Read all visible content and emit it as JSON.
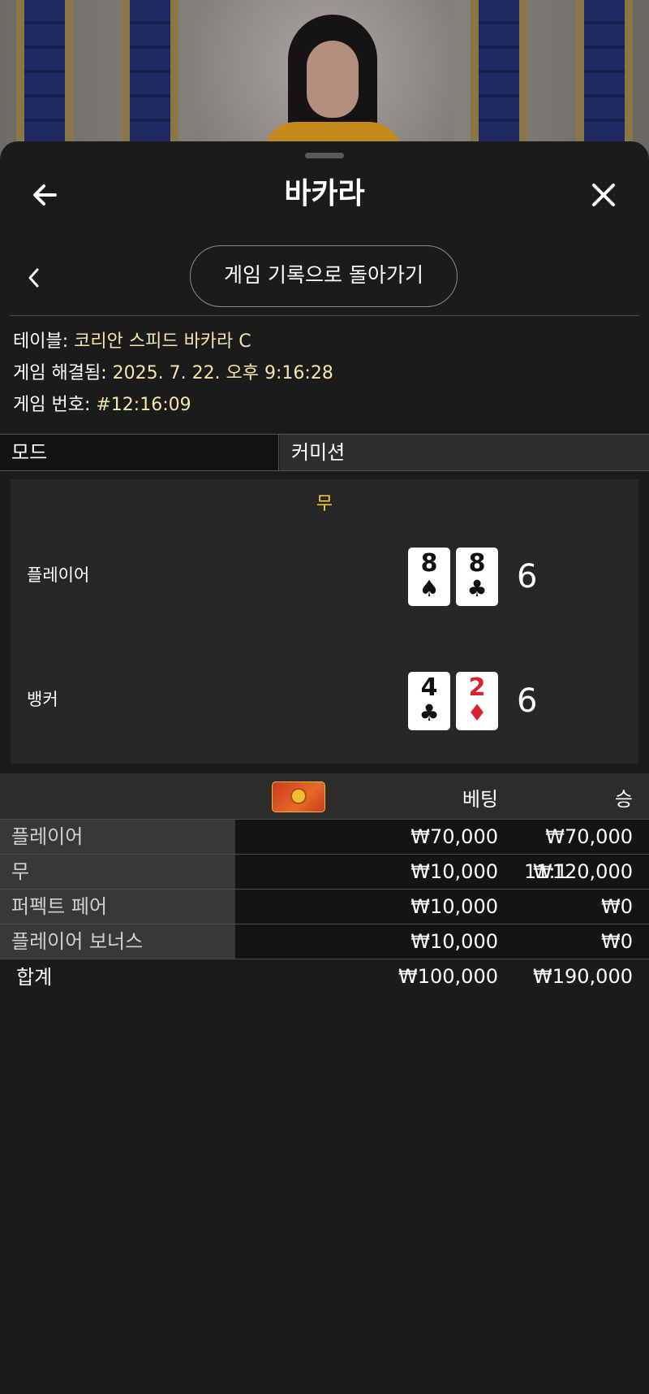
{
  "header": {
    "title": "바카라"
  },
  "history_button": {
    "label": "게임 기록으로 돌아가기"
  },
  "info": {
    "table_label": "테이블:",
    "table_value": "코리안 스피드 바카라 C",
    "resolved_label": "게임 해결됨:",
    "resolved_value": "2025. 7. 22. 오후 9:16:28",
    "number_label": "게임 번호:",
    "number_value": "#12:16:09"
  },
  "mode": {
    "left": "모드",
    "right": "커미션"
  },
  "result": {
    "outcome": "무",
    "player": {
      "label": "플레이어",
      "cards": [
        {
          "rank": "8",
          "suit": "♠",
          "color": "black"
        },
        {
          "rank": "8",
          "suit": "♣",
          "color": "black"
        }
      ],
      "score": "6"
    },
    "banker": {
      "label": "뱅커",
      "cards": [
        {
          "rank": "4",
          "suit": "♣",
          "color": "black"
        },
        {
          "rank": "2",
          "suit": "♦",
          "color": "red"
        }
      ],
      "score": "6"
    }
  },
  "bets": {
    "columns": {
      "bet": "베팅",
      "win": "승"
    },
    "rows": [
      {
        "name": "플레이어",
        "odds": "",
        "bet": "₩70,000",
        "win": "₩70,000"
      },
      {
        "name": "무",
        "odds": "11:1",
        "bet": "₩10,000",
        "win": "₩120,000"
      },
      {
        "name": "퍼펙트 페어",
        "odds": "",
        "bet": "₩10,000",
        "win": "₩0"
      },
      {
        "name": "플레이어 보너스",
        "odds": "",
        "bet": "₩10,000",
        "win": "₩0"
      }
    ],
    "total": {
      "name": "합계",
      "bet": "₩100,000",
      "win": "₩190,000"
    }
  },
  "icons": {
    "back": "arrow-left-icon",
    "close": "close-icon",
    "prev": "chevron-left-icon",
    "chip": "chip-icon"
  },
  "colors": {
    "outcome": "#f4cf2c",
    "info_value": "#f3e6a8",
    "red_suit": "#d6232e"
  }
}
